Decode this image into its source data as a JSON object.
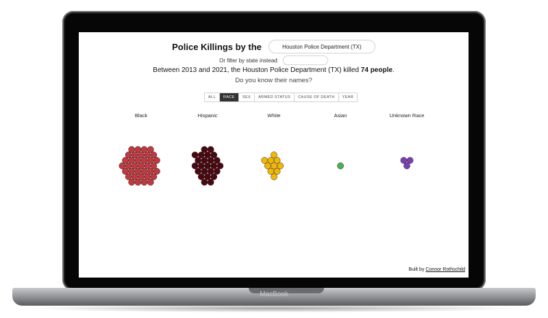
{
  "device": {
    "brand_label": "MacBook"
  },
  "header": {
    "title": "Police Killings by the",
    "department_value": "Houston Police Department (TX)",
    "filter_label": "Or filter by state instead:",
    "state_value": ""
  },
  "summary": {
    "prefix": "Between 2013 and 2021, the Houston Police Department (TX) killed ",
    "count_text": "74 people",
    "suffix": ".",
    "question": "Do you know their names?"
  },
  "tabs": [
    {
      "label": "ALL",
      "active": false
    },
    {
      "label": "RACE",
      "active": true
    },
    {
      "label": "SEX",
      "active": false
    },
    {
      "label": "ARMED STATUS",
      "active": false
    },
    {
      "label": "CAUSE OF DEATH",
      "active": false
    },
    {
      "label": "YEAR",
      "active": false
    }
  ],
  "groups": [
    {
      "label": "Black",
      "count": 36,
      "color": "#c0393f"
    },
    {
      "label": "Hispanic",
      "count": 24,
      "color": "#4a0810"
    },
    {
      "label": "White",
      "count": 10,
      "color": "#f2b705"
    },
    {
      "label": "Asian",
      "count": 1,
      "color": "#4caf50"
    },
    {
      "label": "Unknown Race",
      "count": 3,
      "color": "#7a3fb0"
    }
  ],
  "footer": {
    "prefix": "Built by ",
    "author": "Connor Rothschild"
  }
}
